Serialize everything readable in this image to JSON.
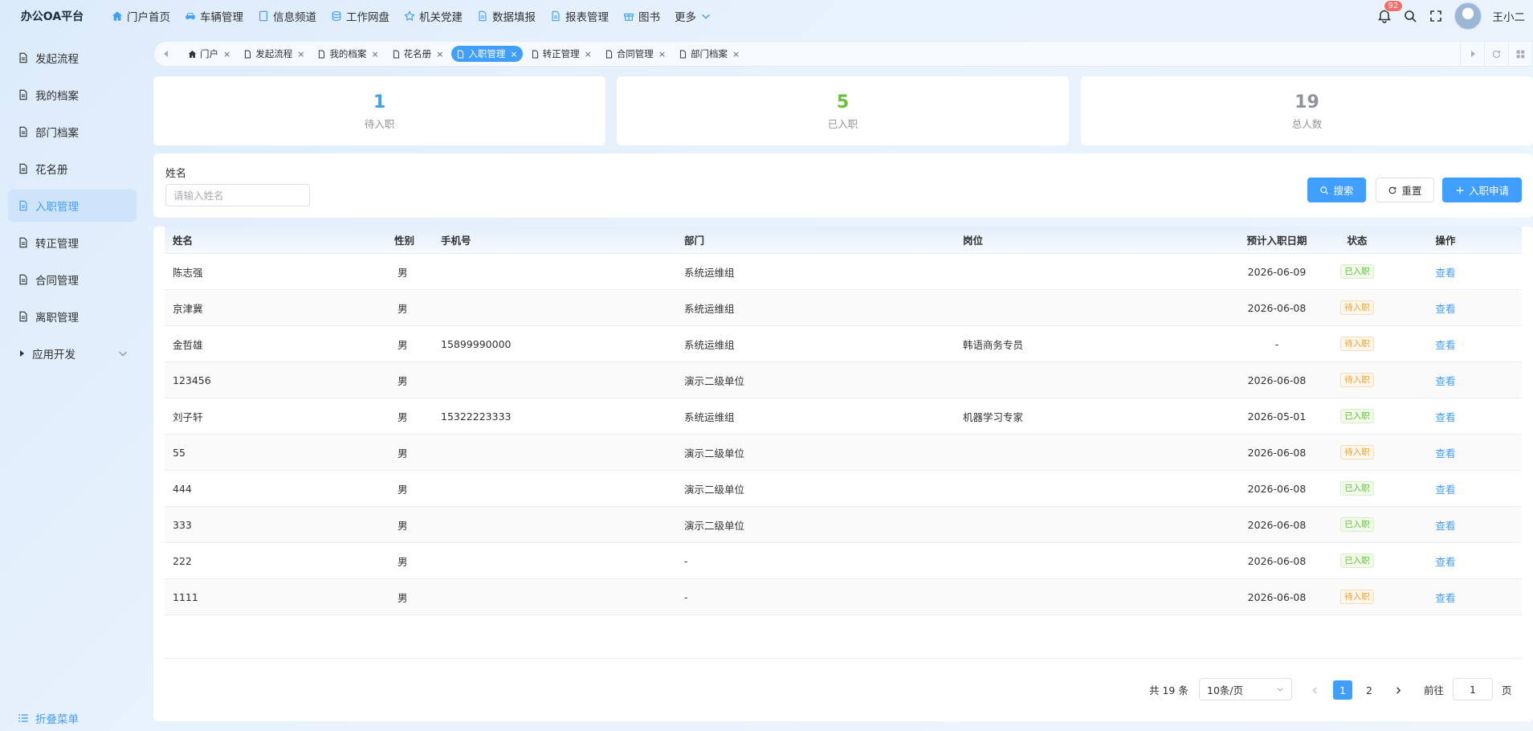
{
  "app": {
    "title": "办公OA平台"
  },
  "topnav": [
    {
      "label": "门户首页",
      "icon": "home-icon"
    },
    {
      "label": "车辆管理",
      "icon": "car-icon"
    },
    {
      "label": "信息频道",
      "icon": "document-icon"
    },
    {
      "label": "工作网盘",
      "icon": "database-icon"
    },
    {
      "label": "机关党建",
      "icon": "star-icon"
    },
    {
      "label": "数据填报",
      "icon": "file-icon"
    },
    {
      "label": "报表管理",
      "icon": "file-icon"
    },
    {
      "label": "图书",
      "icon": "gift-icon"
    },
    {
      "label": "更多",
      "icon": "chevron-down-icon"
    }
  ],
  "user": {
    "notification_count": "92",
    "name": "王小二"
  },
  "sidebar": {
    "items": [
      {
        "label": "发起流程"
      },
      {
        "label": "我的档案"
      },
      {
        "label": "部门档案"
      },
      {
        "label": "花名册"
      },
      {
        "label": "入职管理",
        "active": true
      },
      {
        "label": "转正管理"
      },
      {
        "label": "合同管理"
      },
      {
        "label": "离职管理"
      },
      {
        "label": "应用开发",
        "expandable": true
      }
    ],
    "collapse_label": "折叠菜单"
  },
  "tabs": [
    {
      "label": "门户"
    },
    {
      "label": "发起流程"
    },
    {
      "label": "我的档案"
    },
    {
      "label": "花名册"
    },
    {
      "label": "入职管理",
      "active": true
    },
    {
      "label": "转正管理"
    },
    {
      "label": "合同管理"
    },
    {
      "label": "部门档案"
    }
  ],
  "stats": [
    {
      "value": "1",
      "label": "待入职",
      "color": "#409eff"
    },
    {
      "value": "5",
      "label": "已入职",
      "color": "#67c23a"
    },
    {
      "value": "19",
      "label": "总人数",
      "color": "#909399"
    }
  ],
  "search": {
    "name_label": "姓名",
    "name_placeholder": "请输入姓名",
    "search_label": "搜索",
    "reset_label": "重置",
    "apply_label": "入职申请"
  },
  "table": {
    "columns": [
      "姓名",
      "性别",
      "手机号",
      "部门",
      "岗位",
      "预计入职日期",
      "状态",
      "操作"
    ],
    "rows": [
      {
        "name": "陈志强",
        "gender": "男",
        "phone": "",
        "dept": "系统运维组",
        "position": "",
        "date": "2026-06-09",
        "status": "已入职",
        "action": "查看"
      },
      {
        "name": "京津冀",
        "gender": "男",
        "phone": "",
        "dept": "系统运维组",
        "position": "",
        "date": "2026-06-08",
        "status": "待入职",
        "action": "查看"
      },
      {
        "name": "金哲雄",
        "gender": "男",
        "phone": "15899990000",
        "dept": "系统运维组",
        "position": "韩语商务专员",
        "date": "-",
        "status": "待入职",
        "action": "查看"
      },
      {
        "name": "123456",
        "gender": "男",
        "phone": "",
        "dept": "演示二级单位",
        "position": "",
        "date": "2026-06-08",
        "status": "待入职",
        "action": "查看"
      },
      {
        "name": "刘子轩",
        "gender": "男",
        "phone": "15322223333",
        "dept": "系统运维组",
        "position": "机器学习专家",
        "date": "2026-05-01",
        "status": "已入职",
        "action": "查看"
      },
      {
        "name": "55",
        "gender": "男",
        "phone": "",
        "dept": "演示二级单位",
        "position": "",
        "date": "2026-06-08",
        "status": "待入职",
        "action": "查看"
      },
      {
        "name": "444",
        "gender": "男",
        "phone": "",
        "dept": "演示二级单位",
        "position": "",
        "date": "2026-06-08",
        "status": "已入职",
        "action": "查看"
      },
      {
        "name": "333",
        "gender": "男",
        "phone": "",
        "dept": "演示二级单位",
        "position": "",
        "date": "2026-06-08",
        "status": "已入职",
        "action": "查看"
      },
      {
        "name": "222",
        "gender": "男",
        "phone": "",
        "dept": "-",
        "position": "",
        "date": "2026-06-08",
        "status": "已入职",
        "action": "查看"
      },
      {
        "name": "1111",
        "gender": "男",
        "phone": "",
        "dept": "-",
        "position": "",
        "date": "2026-06-08",
        "status": "待入职",
        "action": "查看"
      }
    ]
  },
  "pagination": {
    "total_text": "共 19 条",
    "page_size": "10条/页",
    "pages": [
      "1",
      "2"
    ],
    "current_page": "1",
    "goto_label": "前往",
    "goto_value": "1",
    "page_unit": "页"
  }
}
